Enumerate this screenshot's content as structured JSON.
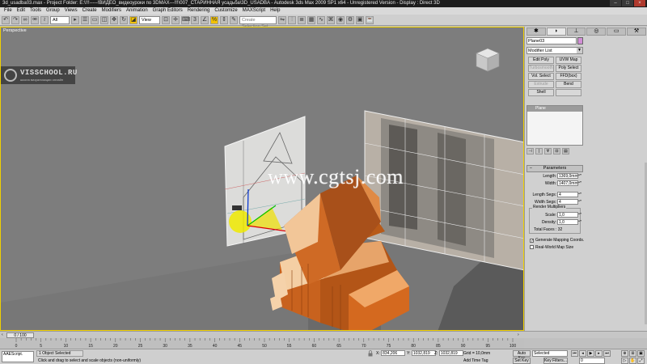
{
  "title": "3d_usadba03.max   -  Project Folder: E:\\!!!-----!ВИДЕО_видеоуроки по 3DMAX---!!!\\007_СТАРИННАЯ усадьба\\3D_USADBA    -  Autodesk 3ds Max 2009 SP1  x64   -  Unregistered Version     -  Display : Direct 3D",
  "menu": [
    "File",
    "Edit",
    "Tools",
    "Group",
    "Views",
    "Create",
    "Modifiers",
    "Animation",
    "Graph Editors",
    "Rendering",
    "Customize",
    "MAXScript",
    "Help"
  ],
  "toolbar": {
    "filter": "All",
    "ref_coord": "View",
    "selection_set_placeholder": "Create Selection Set"
  },
  "viewport": {
    "label": "Perspective",
    "watermark": "www.cgtsj.com",
    "logo_main": "VISSCHOOL.RU",
    "logo_sub": "школа визуализации онлайн"
  },
  "command_panel": {
    "object_name": "Plane03",
    "object_color": "#d28ed6",
    "modifier_list": "Modifier List",
    "modifier_buttons": [
      "Edit Poly",
      "UVW Map",
      "Turbosmooth",
      "Poly Select",
      "Vol. Select",
      "FFD(box)",
      "Extrude",
      "Bend",
      "Shell",
      ""
    ],
    "modifier_buttons_dim": [
      false,
      false,
      true,
      false,
      false,
      false,
      true,
      false,
      false,
      false
    ],
    "stack": [
      "Plane"
    ],
    "rollout_title": "Parameters",
    "length_label": "Length:",
    "length_value": "1369,0mm",
    "width_label": "Width:",
    "width_value": "1407,0mm",
    "length_segs_label": "Length Segs:",
    "length_segs_value": "4",
    "width_segs_label": "Width Segs:",
    "width_segs_value": "4",
    "render_multipliers": "Render Multipliers",
    "scale_label": "Scale:",
    "scale_value": "1,0",
    "density_label": "Density:",
    "density_value": "1,0",
    "total_faces": "Total Faces : 32",
    "gen_mapping": "Generate Mapping Coords.",
    "gen_mapping_checked": true,
    "real_world": "Real-World Map Size",
    "real_world_checked": false
  },
  "timeline": {
    "slider_label": "0 / 100",
    "ticks": [
      "0",
      "5",
      "10",
      "15",
      "20",
      "25",
      "30",
      "35",
      "40",
      "45",
      "50",
      "55",
      "60",
      "65",
      "70",
      "75",
      "80",
      "85",
      "90",
      "95",
      "100"
    ]
  },
  "status": {
    "maxscript": "AAEScript.",
    "selection": "1 Object Selected",
    "prompt": "Click and drag to select and scale objects (non-uniformly)",
    "x_label": "X:",
    "x": "834,206",
    "y_label": "Y:",
    "y": "1032,819",
    "z_label": "Z:",
    "z": "1032,819",
    "grid": "Grid = 10,0mm",
    "add_time_tag": "Add Time Tag",
    "auto_key": "Auto Key",
    "set_key": "Set Key",
    "selected": "Selected",
    "key_filters": "Key Filters...",
    "frame": "0"
  }
}
